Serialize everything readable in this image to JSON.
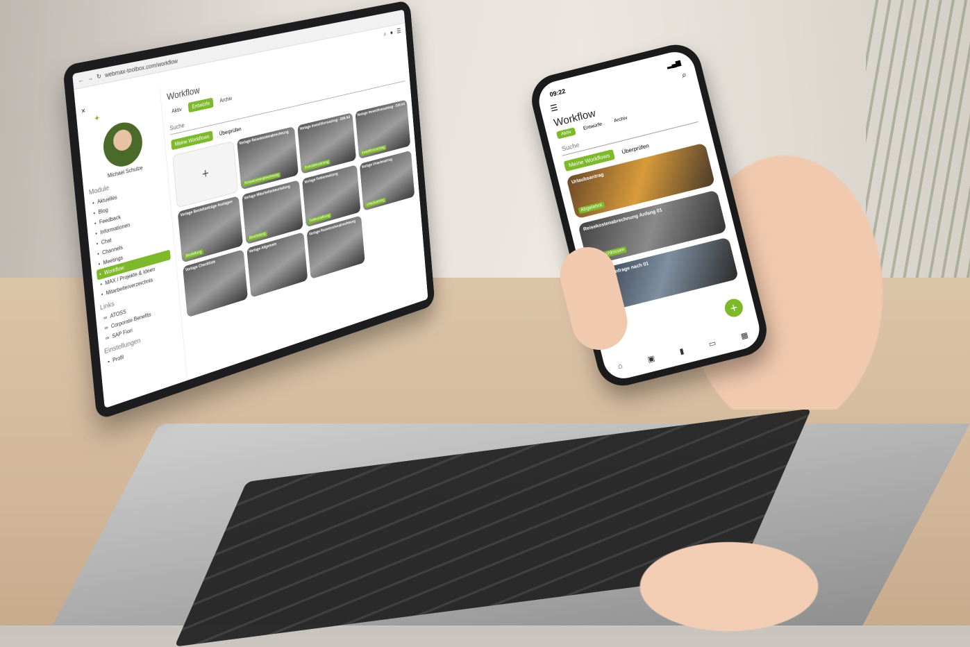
{
  "laptop": {
    "address": "webmax-toolbox.com/workflow",
    "title": "Workflow",
    "user_name": "Michael Schulze",
    "filter_pills": [
      {
        "label": "Aktiv",
        "active": false
      },
      {
        "label": "Entwürfe",
        "active": true
      },
      {
        "label": "Archiv",
        "active": false
      }
    ],
    "search_placeholder": "Suche",
    "tabs": [
      {
        "label": "Meine Workflows",
        "active": true
      },
      {
        "label": "Überprüfen",
        "active": false
      }
    ],
    "sections": {
      "module": "Module",
      "links": "Links",
      "settings": "Einstellungen"
    },
    "nav_items": [
      {
        "label": "Aktuelles",
        "icon": "home-icon"
      },
      {
        "label": "Blog",
        "icon": "blog-icon"
      },
      {
        "label": "Feedback",
        "icon": "feedback-icon"
      },
      {
        "label": "Informationen",
        "icon": "info-icon"
      },
      {
        "label": "Chat",
        "icon": "chat-icon"
      },
      {
        "label": "Channels",
        "icon": "channels-icon"
      },
      {
        "label": "Meetings",
        "icon": "meetings-icon"
      },
      {
        "label": "Workflow",
        "icon": "workflow-icon",
        "active": true
      },
      {
        "label": "MAX / Projekte & Ideen",
        "icon": "ideas-icon"
      },
      {
        "label": "Mitarbeiterverzeichnis",
        "icon": "people-icon"
      }
    ],
    "links": [
      {
        "label": "ATOSS"
      },
      {
        "label": "Corporate Benefits"
      },
      {
        "label": "SAP Fiori"
      }
    ],
    "settings_items": [
      {
        "label": "Profil"
      }
    ],
    "cards": [
      {
        "label": "",
        "badge": ""
      },
      {
        "label": "Vorlage Reisekostenabrechnung",
        "badge": "Reisekostenabrechnung"
      },
      {
        "label": "Vorlage Investitionsantrag - DIN A4",
        "badge": "Investitionsantrag"
      },
      {
        "label": "Vorlage Investitionsantrag - DIN A4",
        "badge": "Investitionsantrag"
      },
      {
        "label": "Vorlage Bestellanträge Auslagen",
        "badge": "Bestellung"
      },
      {
        "label": "Vorlage Mitarbeiterbeurteilung",
        "badge": "Beurteilung"
      },
      {
        "label": "Vorlage Fehlermeldung",
        "badge": "Fehlermeldung"
      },
      {
        "label": "Vorlage Urlaubsantrag",
        "badge": "Urlaubsantrag"
      },
      {
        "label": "Vorlage Checkliste",
        "badge": ""
      },
      {
        "label": "Vorlage Allgemein",
        "badge": ""
      },
      {
        "label": "Vorlage Reisekostenabrechnung",
        "badge": ""
      }
    ],
    "add_symbol": "+"
  },
  "phone": {
    "time": "09:22",
    "title": "Workflow",
    "filter_pills": [
      {
        "label": "Aktiv",
        "active": true
      },
      {
        "label": "Entwürfe",
        "active": false
      },
      {
        "label": "Archiv",
        "active": false
      }
    ],
    "search_placeholder": "Suche",
    "tabs": [
      {
        "label": "Meine Workflows",
        "active": true
      },
      {
        "label": "Überprüfen",
        "active": false
      }
    ],
    "cards": [
      {
        "label": "Urlaubsantrag",
        "badge": "Abgelehnt"
      },
      {
        "label": "Reisekostenabrechnung Anfang 01",
        "badge": "Abgeschlossen"
      },
      {
        "label": "Urlaubsanfrage nach 01",
        "badge": "Entwurf"
      }
    ],
    "fab": "+"
  },
  "colors": {
    "accent": "#7db92b"
  }
}
